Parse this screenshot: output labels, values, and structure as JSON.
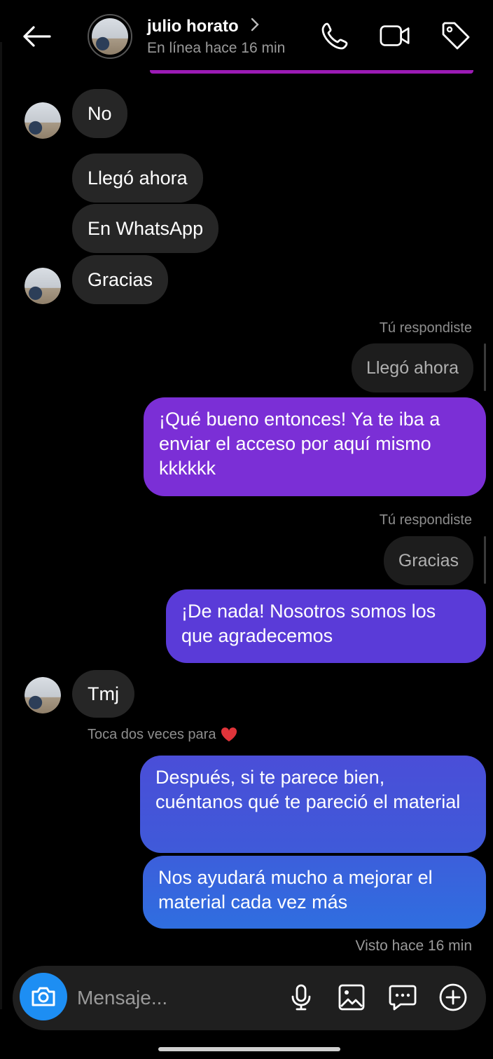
{
  "header": {
    "contact_name": "julio horato",
    "contact_status": "En línea hace 16 min"
  },
  "messages": {
    "m1": "No",
    "m2": "Llegó ahora",
    "m3": "En WhatsApp",
    "m4": "Gracias",
    "reply1_label": "Tú respondiste",
    "reply1_quote": "Llegó ahora",
    "out1": "¡Qué bueno entonces! Ya te iba a enviar el acceso por aquí mismo kkkkkk",
    "reply2_label": "Tú respondiste",
    "reply2_quote": "Gracias",
    "out2": "¡De nada! Nosotros somos los que agradecemos",
    "m5": "Tmj",
    "hint": "Toca dos veces para",
    "out3": "Después, si te parece bien, cuéntanos qué te pareció el material",
    "out4": "Nos ayudará mucho a mejorar el material cada vez más",
    "seen": "Visto hace 16 min"
  },
  "composer": {
    "placeholder": "Mensaje..."
  },
  "colors": {
    "accent_blue": "#1d8ef3",
    "bubble_purple": "#7b2fd6",
    "bubble_indigo": "#5a3bd8",
    "bubble_blue": "#3f57d9",
    "incoming_bubble": "#262626"
  },
  "icons": [
    "back-arrow-icon",
    "chevron-right-icon",
    "phone-icon",
    "video-icon",
    "tag-icon",
    "heart-icon",
    "camera-icon",
    "microphone-icon",
    "gallery-icon",
    "sticker-icon",
    "plus-icon"
  ]
}
